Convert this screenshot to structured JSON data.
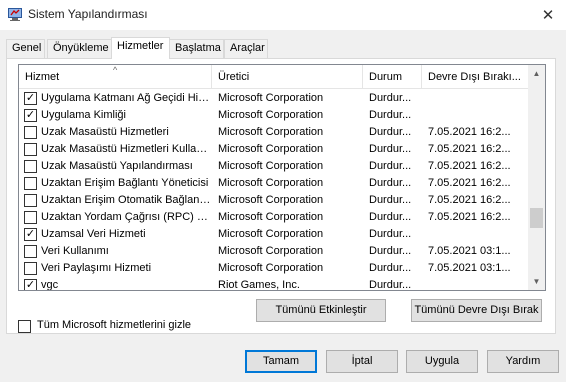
{
  "window": {
    "title": "Sistem Yapılandırması",
    "icon": "msconfig-icon",
    "close_glyph": "✕"
  },
  "tabs": [
    {
      "label": "Genel",
      "active": false
    },
    {
      "label": "Önyükleme",
      "active": false
    },
    {
      "label": "Hizmetler",
      "active": true
    },
    {
      "label": "Başlatma",
      "active": false
    },
    {
      "label": "Araçlar",
      "active": false
    }
  ],
  "services": {
    "columns": {
      "service": "Hizmet",
      "manufacturer": "Üretici",
      "status": "Durum",
      "disabled_date": "Devre Dışı Bırakı..."
    },
    "rows": [
      {
        "checked": true,
        "service": "Uygulama Katmanı Ağ Geçidi Hiz...",
        "manufacturer": "Microsoft Corporation",
        "status": "Durdur...",
        "date": ""
      },
      {
        "checked": true,
        "service": "Uygulama Kimliği",
        "manufacturer": "Microsoft Corporation",
        "status": "Durdur...",
        "date": ""
      },
      {
        "checked": false,
        "service": "Uzak Masaüstü Hizmetleri",
        "manufacturer": "Microsoft Corporation",
        "status": "Durdur...",
        "date": "7.05.2021 16:2..."
      },
      {
        "checked": false,
        "service": "Uzak Masaüstü Hizmetleri Kullanı...",
        "manufacturer": "Microsoft Corporation",
        "status": "Durdur...",
        "date": "7.05.2021 16:2..."
      },
      {
        "checked": false,
        "service": "Uzak Masaüstü Yapılandırması",
        "manufacturer": "Microsoft Corporation",
        "status": "Durdur...",
        "date": "7.05.2021 16:2..."
      },
      {
        "checked": false,
        "service": "Uzaktan Erişim Bağlantı Yöneticisi",
        "manufacturer": "Microsoft Corporation",
        "status": "Durdur...",
        "date": "7.05.2021 16:2..."
      },
      {
        "checked": false,
        "service": "Uzaktan Erişim Otomatik Bağlantı...",
        "manufacturer": "Microsoft Corporation",
        "status": "Durdur...",
        "date": "7.05.2021 16:2..."
      },
      {
        "checked": false,
        "service": "Uzaktan Yordam Çağrısı (RPC) K...",
        "manufacturer": "Microsoft Corporation",
        "status": "Durdur...",
        "date": "7.05.2021 16:2..."
      },
      {
        "checked": true,
        "service": "Uzamsal Veri Hizmeti",
        "manufacturer": "Microsoft Corporation",
        "status": "Durdur...",
        "date": ""
      },
      {
        "checked": false,
        "service": "Veri Kullanımı",
        "manufacturer": "Microsoft Corporation",
        "status": "Durdur...",
        "date": "7.05.2021 03:1..."
      },
      {
        "checked": false,
        "service": "Veri Paylaşımı Hizmeti",
        "manufacturer": "Microsoft Corporation",
        "status": "Durdur...",
        "date": "7.05.2021 03:1..."
      },
      {
        "checked": true,
        "service": "vgc",
        "manufacturer": "Riot Games, Inc.",
        "status": "Durdur...",
        "date": ""
      }
    ]
  },
  "buttons": {
    "enable_all": "Tümünü Etkinleştir",
    "disable_all": "Tümünü Devre Dışı Bırak",
    "ok": "Tamam",
    "cancel": "İptal",
    "apply": "Uygula",
    "help": "Yardım"
  },
  "hide_ms": {
    "label": "Tüm Microsoft hizmetlerini gizle",
    "checked": false
  }
}
